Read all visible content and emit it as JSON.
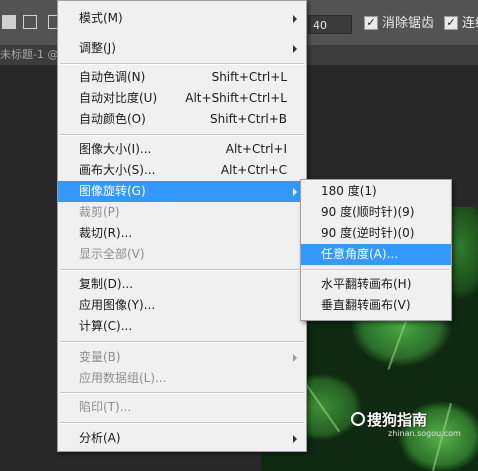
{
  "options_bar": {
    "size_value": "40",
    "anti_alias_label": "消除锯齿",
    "anti_alias_checked": true,
    "contiguous_label": "连续",
    "contiguous_checked": true,
    "check_glyph": "✓"
  },
  "document_tab": {
    "title": "未标题-1 @"
  },
  "main_menu": {
    "groups": [
      {
        "items": [
          {
            "label": "模式(M)",
            "shortcut": "",
            "submenu": true,
            "disabled": false,
            "highlighted": false
          },
          {
            "label": "调整(J)",
            "shortcut": "",
            "submenu": true,
            "disabled": false,
            "highlighted": false
          }
        ]
      }
    ],
    "items": [
      {
        "label": "模式(M)",
        "shortcut": "",
        "submenu": true,
        "disabled": false,
        "highlighted": false
      },
      {
        "label": "调整(J)",
        "shortcut": "",
        "submenu": true,
        "disabled": false,
        "highlighted": false
      },
      {
        "label": "自动色调(N)",
        "shortcut": "Shift+Ctrl+L",
        "submenu": false,
        "disabled": false,
        "highlighted": false
      },
      {
        "label": "自动对比度(U)",
        "shortcut": "Alt+Shift+Ctrl+L",
        "submenu": false,
        "disabled": false,
        "highlighted": false
      },
      {
        "label": "自动颜色(O)",
        "shortcut": "Shift+Ctrl+B",
        "submenu": false,
        "disabled": false,
        "highlighted": false
      },
      {
        "label": "图像大小(I)...",
        "shortcut": "Alt+Ctrl+I",
        "submenu": false,
        "disabled": false,
        "highlighted": false
      },
      {
        "label": "画布大小(S)...",
        "shortcut": "Alt+Ctrl+C",
        "submenu": false,
        "disabled": false,
        "highlighted": false
      },
      {
        "label": "图像旋转(G)",
        "shortcut": "",
        "submenu": true,
        "disabled": false,
        "highlighted": true
      },
      {
        "label": "裁剪(P)",
        "shortcut": "",
        "submenu": false,
        "disabled": true,
        "highlighted": false
      },
      {
        "label": "裁切(R)...",
        "shortcut": "",
        "submenu": false,
        "disabled": false,
        "highlighted": false
      },
      {
        "label": "显示全部(V)",
        "shortcut": "",
        "submenu": false,
        "disabled": true,
        "highlighted": false
      },
      {
        "label": "复制(D)...",
        "shortcut": "",
        "submenu": false,
        "disabled": false,
        "highlighted": false
      },
      {
        "label": "应用图像(Y)...",
        "shortcut": "",
        "submenu": false,
        "disabled": false,
        "highlighted": false
      },
      {
        "label": "计算(C)...",
        "shortcut": "",
        "submenu": false,
        "disabled": false,
        "highlighted": false
      },
      {
        "label": "变量(B)",
        "shortcut": "",
        "submenu": true,
        "disabled": true,
        "highlighted": false
      },
      {
        "label": "应用数据组(L)...",
        "shortcut": "",
        "submenu": false,
        "disabled": true,
        "highlighted": false
      },
      {
        "label": "陷印(T)...",
        "shortcut": "",
        "submenu": false,
        "disabled": true,
        "highlighted": false
      },
      {
        "label": "分析(A)",
        "shortcut": "",
        "submenu": true,
        "disabled": false,
        "highlighted": false
      }
    ]
  },
  "rotate_submenu": {
    "items": [
      {
        "label": "180 度(1)",
        "highlighted": false
      },
      {
        "label": "90 度(顺时针)(9)",
        "highlighted": false
      },
      {
        "label": "90 度(逆时针)(0)",
        "highlighted": false
      },
      {
        "label": "任意角度(A)...",
        "highlighted": true
      },
      {
        "label": "水平翻转画布(H)",
        "highlighted": false
      },
      {
        "label": "垂直翻转画布(V)",
        "highlighted": false
      }
    ]
  },
  "watermark": {
    "brand": "搜狗指南",
    "url": "zhinan.sogou.com"
  },
  "colors": {
    "menu_background": "#f0f0f0",
    "highlight": "#3399ff",
    "disabled_text": "#8e8e8e",
    "workspace": "#282828",
    "options_bar": "#535353"
  }
}
